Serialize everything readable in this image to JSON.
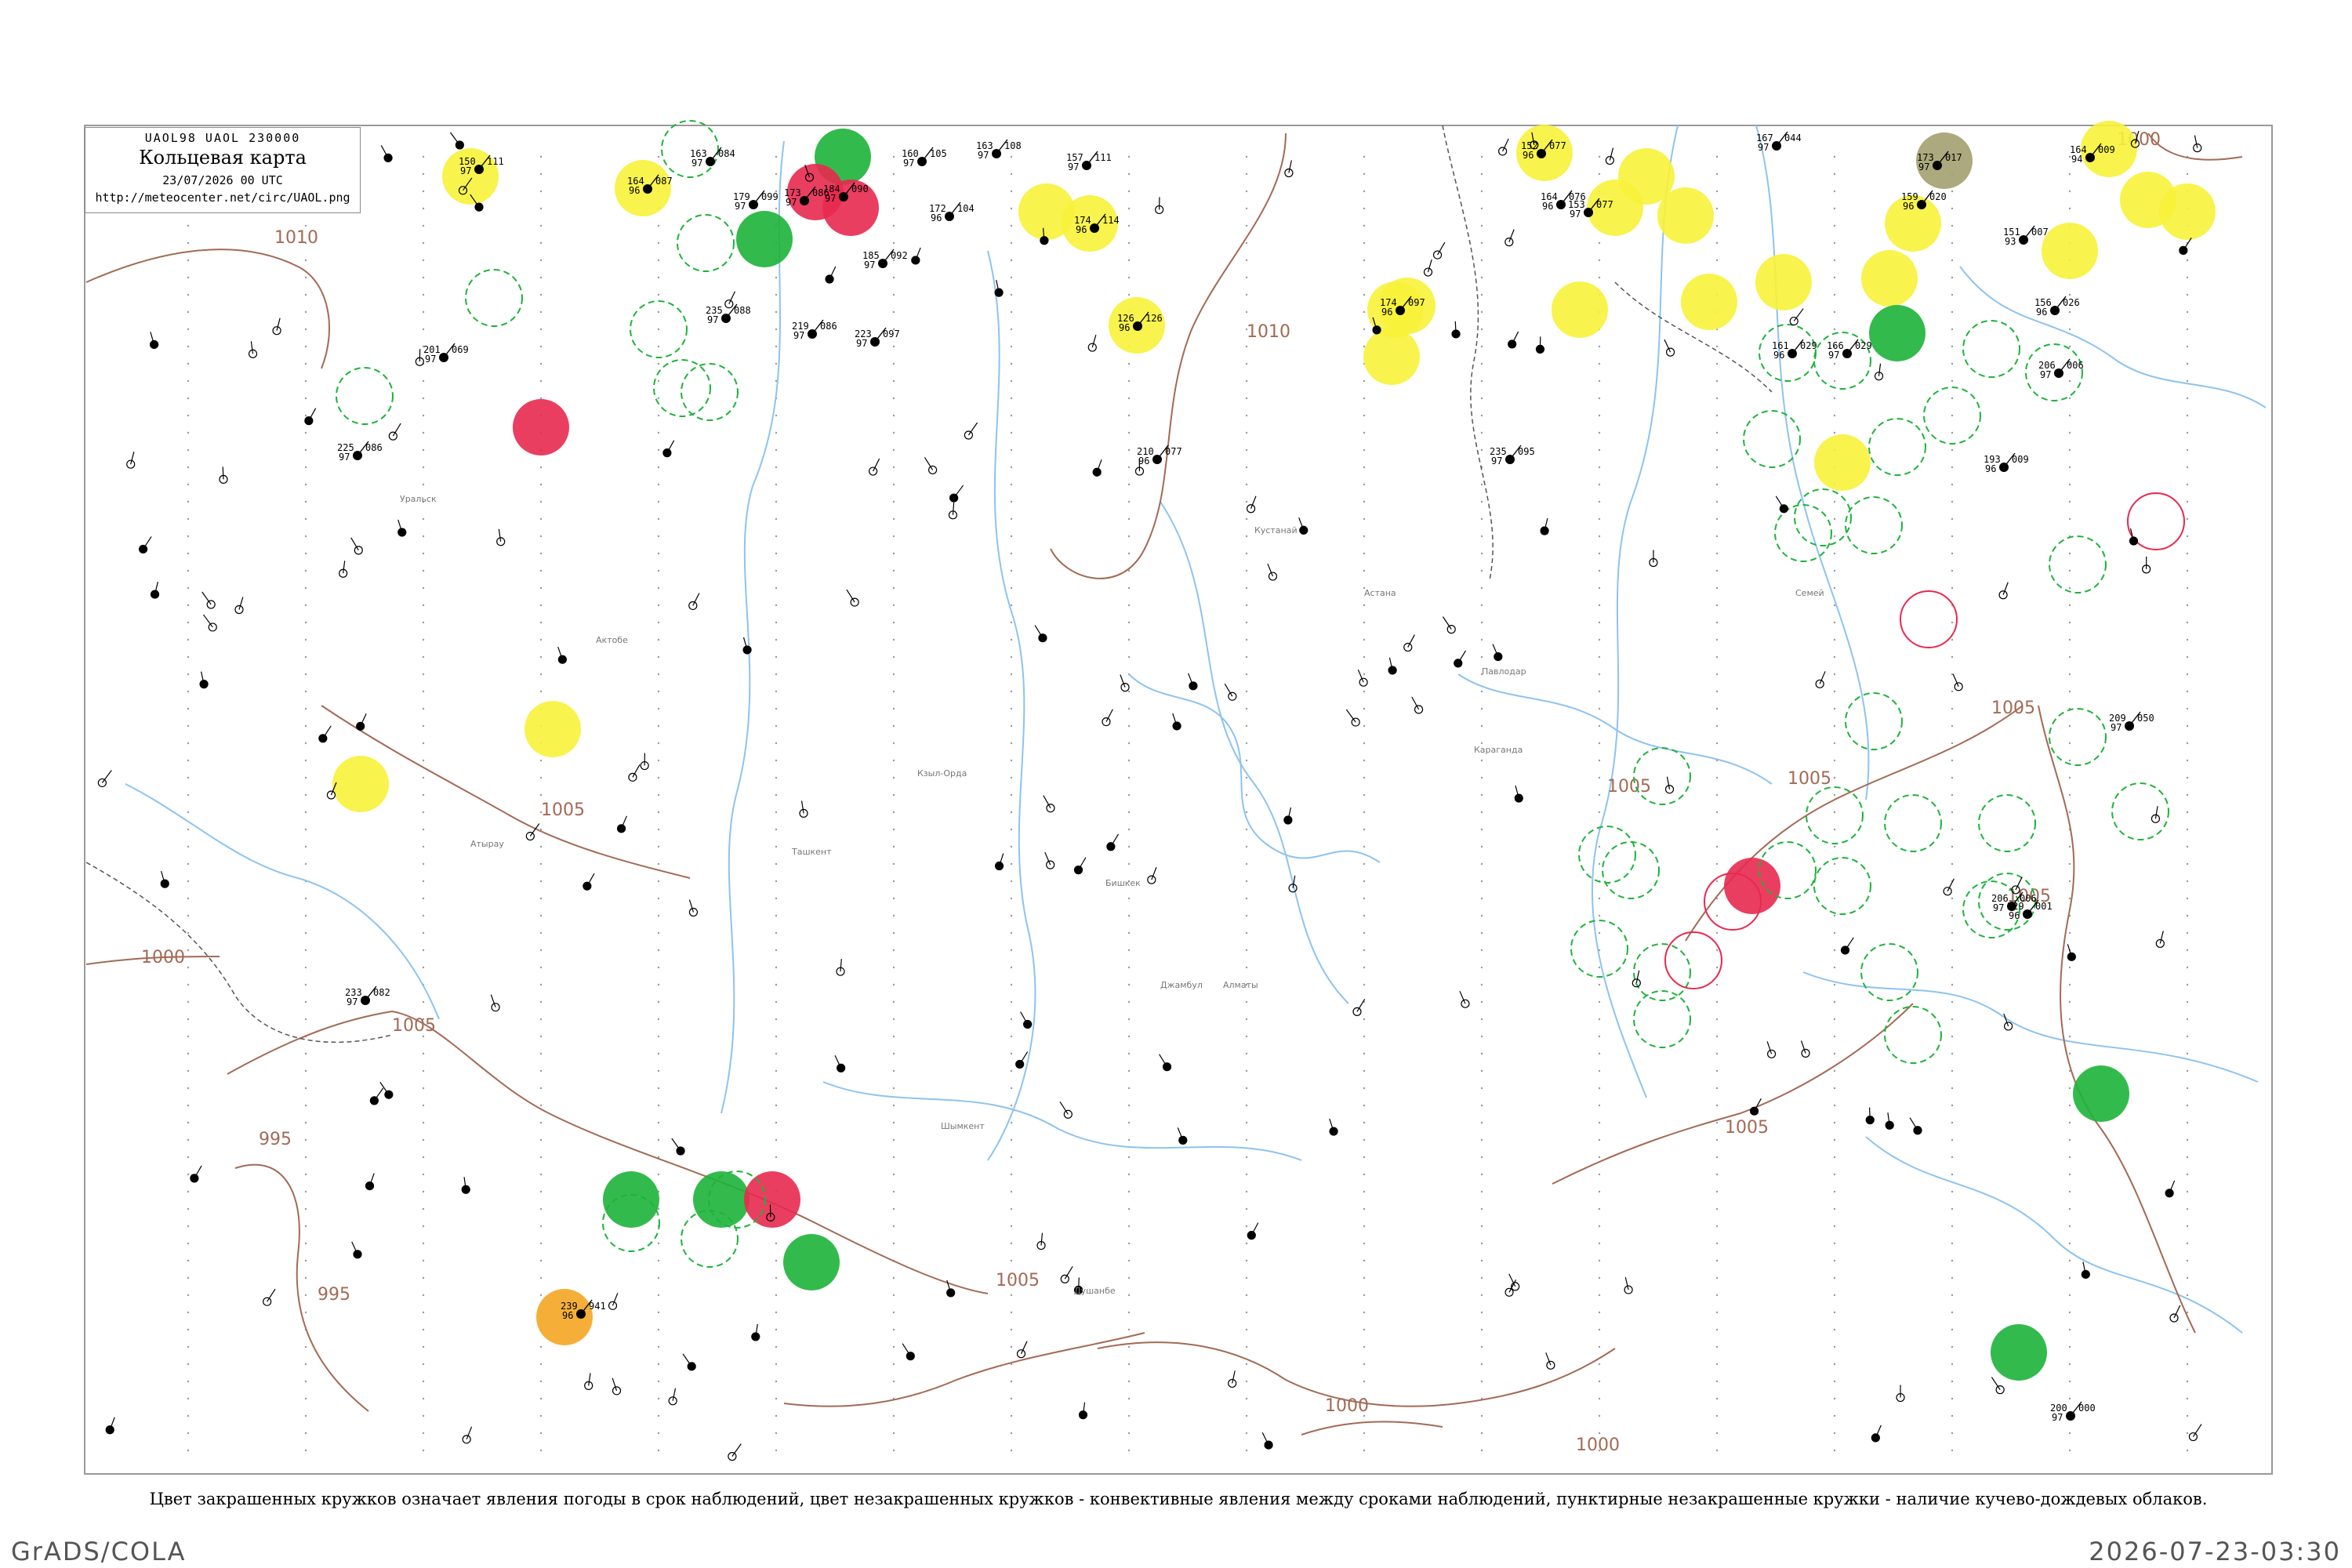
{
  "header": {
    "code": "UAOL98  UAOL  230000",
    "title": "Кольцевая карта",
    "datetime": "23/07/2026 00 UTC",
    "url": "http://meteocenter.net/circ/UAOL.png"
  },
  "caption": "Цвет закрашенных кружков означает явления погоды в срок наблюдений, цвет незакрашенных кружков - конвективные явления между сроками наблюдений, пунктирные незакрашенные кружки - наличие кучево-дождевых облаков.",
  "footer": {
    "left": "GrADS/COLA",
    "right": "2026-07-23-03:30"
  },
  "colors": {
    "rain": "#1db33a",
    "thunder": "#e8294f",
    "yellow": "#f7f23a",
    "orange": "#f4a622",
    "olive": "#a3a070",
    "river": "#8ec3ee",
    "isobar": "#a36a55"
  },
  "isobar_labels": [
    "1010",
    "1010",
    "1005",
    "1000",
    "1005",
    "995",
    "995",
    "1005",
    "1000",
    "1005",
    "1000",
    "1005",
    "1000",
    "1005",
    "1005",
    "1005"
  ],
  "towns": [
    "Ташкент",
    "Бишкек",
    "Алматы",
    "Актобе",
    "Уральск",
    "Атырау",
    "Астана",
    "Караганда",
    "Павлодар",
    "Семей",
    "Душанбе",
    "Кзыл-Орда",
    "Джамбул",
    "Шымкент",
    "Кустанай"
  ],
  "stations": [
    {
      "t": "150",
      "p": "111",
      "w": "97"
    },
    {
      "t": "164",
      "p": "087",
      "w": "96"
    },
    {
      "t": "163",
      "p": "084",
      "w": "97"
    },
    {
      "t": "179",
      "p": "099",
      "w": "97"
    },
    {
      "t": "173",
      "p": "086",
      "w": "97"
    },
    {
      "t": "184",
      "p": "090",
      "w": "97"
    },
    {
      "t": "160",
      "p": "105",
      "w": "97"
    },
    {
      "t": "163",
      "p": "108",
      "w": "97"
    },
    {
      "t": "157",
      "p": "111",
      "w": "97"
    },
    {
      "t": "172",
      "p": "104",
      "w": "96"
    },
    {
      "t": "174",
      "p": "114",
      "w": "96"
    },
    {
      "t": "126",
      "p": "126",
      "w": "96"
    },
    {
      "t": "185",
      "p": "092",
      "w": "97"
    },
    {
      "t": "235",
      "p": "088",
      "w": "97"
    },
    {
      "t": "219",
      "p": "086",
      "w": "97"
    },
    {
      "t": "223",
      "p": "097",
      "w": "97"
    },
    {
      "t": "225",
      "p": "086",
      "w": "97"
    },
    {
      "t": "201",
      "p": "069",
      "w": "97"
    },
    {
      "t": "174",
      "p": "097",
      "w": "96"
    },
    {
      "t": "210",
      "p": "077",
      "w": "96"
    },
    {
      "t": "152",
      "p": "077",
      "w": "96"
    },
    {
      "t": "164",
      "p": "076",
      "w": "96"
    },
    {
      "t": "153",
      "p": "077",
      "w": "97"
    },
    {
      "t": "167",
      "p": "044",
      "w": "97"
    },
    {
      "t": "173",
      "p": "017",
      "w": "97"
    },
    {
      "t": "164",
      "p": "009",
      "w": "94"
    },
    {
      "t": "159",
      "p": "020",
      "w": "96"
    },
    {
      "t": "151",
      "p": "007",
      "w": "93"
    },
    {
      "t": "161",
      "p": "029",
      "w": "96"
    },
    {
      "t": "166",
      "p": "029",
      "w": "97"
    },
    {
      "t": "156",
      "p": "026",
      "w": "96"
    },
    {
      "t": "193",
      "p": "009",
      "w": "96"
    },
    {
      "t": "206",
      "p": "006",
      "w": "97"
    },
    {
      "t": "209",
      "p": "050",
      "w": "97"
    },
    {
      "t": "206",
      "p": "006",
      "w": "97"
    },
    {
      "t": "229",
      "p": "001",
      "w": "96"
    },
    {
      "t": "200",
      "p": "000",
      "w": "97"
    },
    {
      "t": "239",
      "p": "941",
      "w": "96"
    },
    {
      "t": "233",
      "p": "082",
      "w": "97"
    },
    {
      "t": "235",
      "p": "095",
      "w": "97"
    }
  ]
}
